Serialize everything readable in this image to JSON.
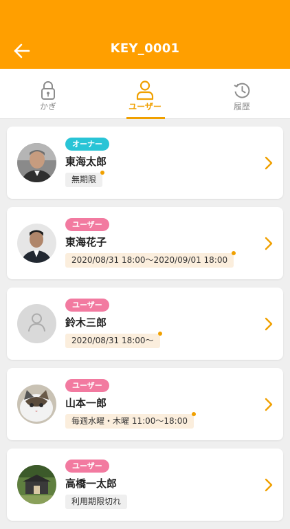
{
  "header": {
    "title": "KEY_0001",
    "back_icon": "arrow-left-icon",
    "color": "#ff9f00"
  },
  "tabs": [
    {
      "label": "かぎ",
      "icon": "padlock-icon",
      "active": false
    },
    {
      "label": "ユーザー",
      "icon": "person-icon",
      "active": true
    },
    {
      "label": "履歴",
      "icon": "history-icon",
      "active": false
    }
  ],
  "users": [
    {
      "role": "オーナー",
      "role_color": "#29c4d6",
      "name": "東海太郎",
      "period": "無期限",
      "period_style": "gray",
      "avatar": "man-photo"
    },
    {
      "role": "ユーザー",
      "role_color": "#f27aa0",
      "name": "東海花子",
      "period": "2020/08/31 18:00～2020/09/01 18:00",
      "period_style": "beige",
      "avatar": "man-photo-2"
    },
    {
      "role": "ユーザー",
      "role_color": "#f27aa0",
      "name": "鈴木三郎",
      "period": "2020/08/31 18:00～",
      "period_style": "beige",
      "avatar": "default-avatar"
    },
    {
      "role": "ユーザー",
      "role_color": "#f27aa0",
      "name": "山本一郎",
      "period": "毎週水曜・木曜 11:00～18:00",
      "period_style": "beige",
      "avatar": "cat-photo"
    },
    {
      "role": "ユーザー",
      "role_color": "#f27aa0",
      "name": "高橋一太郎",
      "period": "利用期限切れ",
      "period_style": "gray",
      "avatar": "house-photo"
    }
  ]
}
